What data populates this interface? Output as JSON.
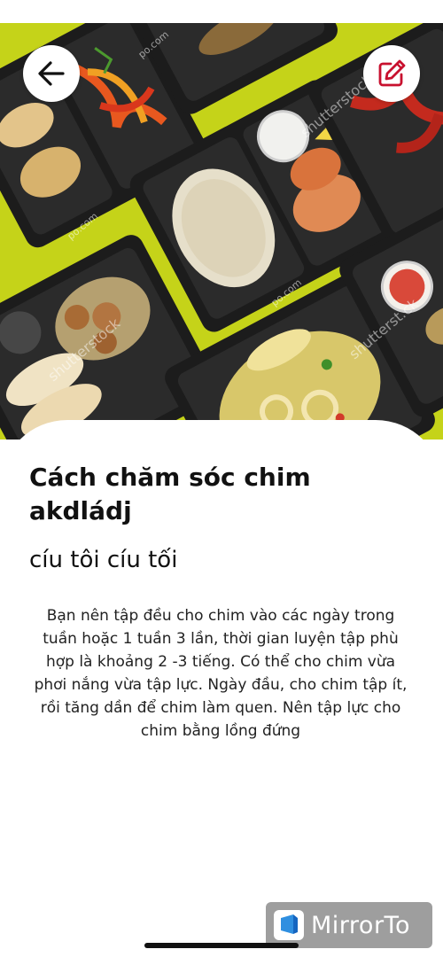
{
  "header": {
    "back_icon": "arrow-left-icon",
    "edit_icon": "pencil-square-icon"
  },
  "hero_image": {
    "description_icon": "food-photo",
    "watermark_texts": [
      "po.com",
      "shutterstock",
      "shutterst.ck"
    ]
  },
  "article": {
    "title": "Cách chăm sóc chim akdládj",
    "subtitle": "cíu tôi cíu tối",
    "body": "Bạn nên tập đều cho chim vào các ngày trong tuần hoặc 1 tuần 3 lần, thời gian luyện tập phù hợp là khoảng 2 -3 tiếng. Có thể cho chim vừa phơi nắng vừa tập lực. Ngày đầu, cho chim tập ít, rồi tăng dần để chim làm quen. Nên tập lực cho chim bằng lồng đứng"
  },
  "overlay": {
    "mirror_label": "MirrorTo"
  },
  "colors": {
    "accent": "#c8102e",
    "background": "#ffffff",
    "text": "#111111"
  }
}
